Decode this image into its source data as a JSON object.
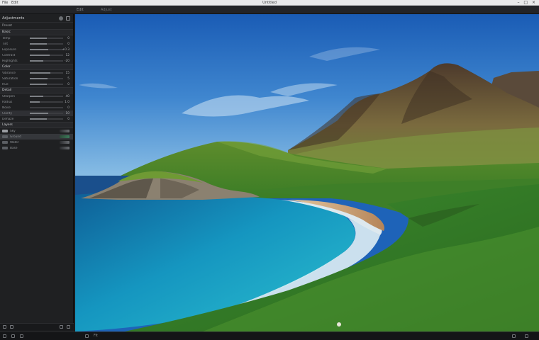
{
  "window": {
    "title": "Untitled",
    "menu": [
      "File",
      "Edit"
    ],
    "controls": "– □ ×"
  },
  "toolbar": {
    "items": [
      "Edit",
      "Adjust"
    ]
  },
  "left_panel": {
    "title": "Adjustments",
    "preset_label": "Preset",
    "sections": [
      {
        "name": "Basic",
        "rows": [
          {
            "label": "Temp",
            "value": "0",
            "fill": 0.5
          },
          {
            "label": "Tint",
            "value": "0",
            "fill": 0.5
          },
          {
            "label": "Exposure",
            "value": "+0.3",
            "fill": 0.55
          },
          {
            "label": "Contrast",
            "value": "12",
            "fill": 0.6
          },
          {
            "label": "Highlights",
            "value": "-20",
            "fill": 0.4
          }
        ]
      },
      {
        "name": "Color",
        "rows": [
          {
            "label": "Vibrance",
            "value": "15",
            "fill": 0.62
          },
          {
            "label": "Saturation",
            "value": "5",
            "fill": 0.54
          },
          {
            "label": "Hue",
            "value": "0",
            "fill": 0.5
          }
        ]
      },
      {
        "name": "Detail",
        "rows": [
          {
            "label": "Sharpen",
            "value": "40",
            "fill": 0.4
          },
          {
            "label": "Radius",
            "value": "1.0",
            "fill": 0.3
          },
          {
            "label": "Noise",
            "value": "0",
            "fill": 0.0
          },
          {
            "label": "Clarity",
            "value": "10",
            "fill": 0.55
          },
          {
            "label": "Dehaze",
            "value": "0",
            "fill": 0.5
          }
        ]
      },
      {
        "name": "Layers",
        "rows": [
          {
            "label": "Sky",
            "value": "",
            "fill": 0
          },
          {
            "label": "Ground",
            "value": "",
            "fill": 0
          },
          {
            "label": "Water",
            "value": "",
            "fill": 0
          },
          {
            "label": "Base",
            "value": "",
            "fill": 0
          }
        ]
      }
    ]
  },
  "status": {
    "zoom": "Fit"
  },
  "colors": {
    "accent": "#3c7b5a",
    "panel_bg": "#1f2022",
    "sky_top": "#1a5cb5",
    "sea": "#1a9cc4",
    "grass": "#3f8a2e"
  },
  "canvas": {
    "subject": "coastal bay with mountains, green hills, sandy beach and turquoise water"
  }
}
